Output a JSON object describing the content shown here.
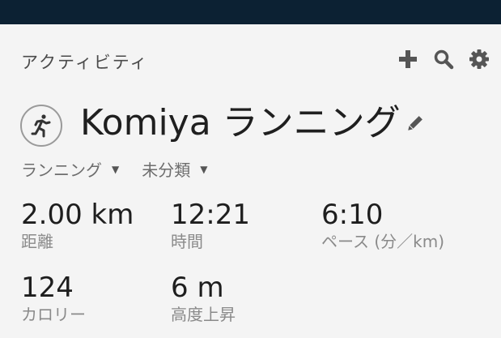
{
  "header": {
    "title": "アクティビティ",
    "icons": [
      "plus-icon",
      "search-icon",
      "gear-icon"
    ]
  },
  "activity": {
    "name": "Komiya ランニング",
    "icon": "runner-icon"
  },
  "dropdowns": {
    "type_label": "ランニング",
    "category_label": "未分類"
  },
  "stats": {
    "distance": {
      "value": "2.00 km",
      "label": "距離"
    },
    "time": {
      "value": "12:21",
      "label": "時間"
    },
    "pace": {
      "value": "6:10",
      "label": "ペース (分／km)"
    },
    "calories": {
      "value": "124",
      "label": "カロリー"
    },
    "elevation": {
      "value": "6 m",
      "label": "高度上昇"
    }
  },
  "colors": {
    "topbar": "#0c2133",
    "background": "#f4f4f4",
    "icon_gray": "#555555"
  }
}
